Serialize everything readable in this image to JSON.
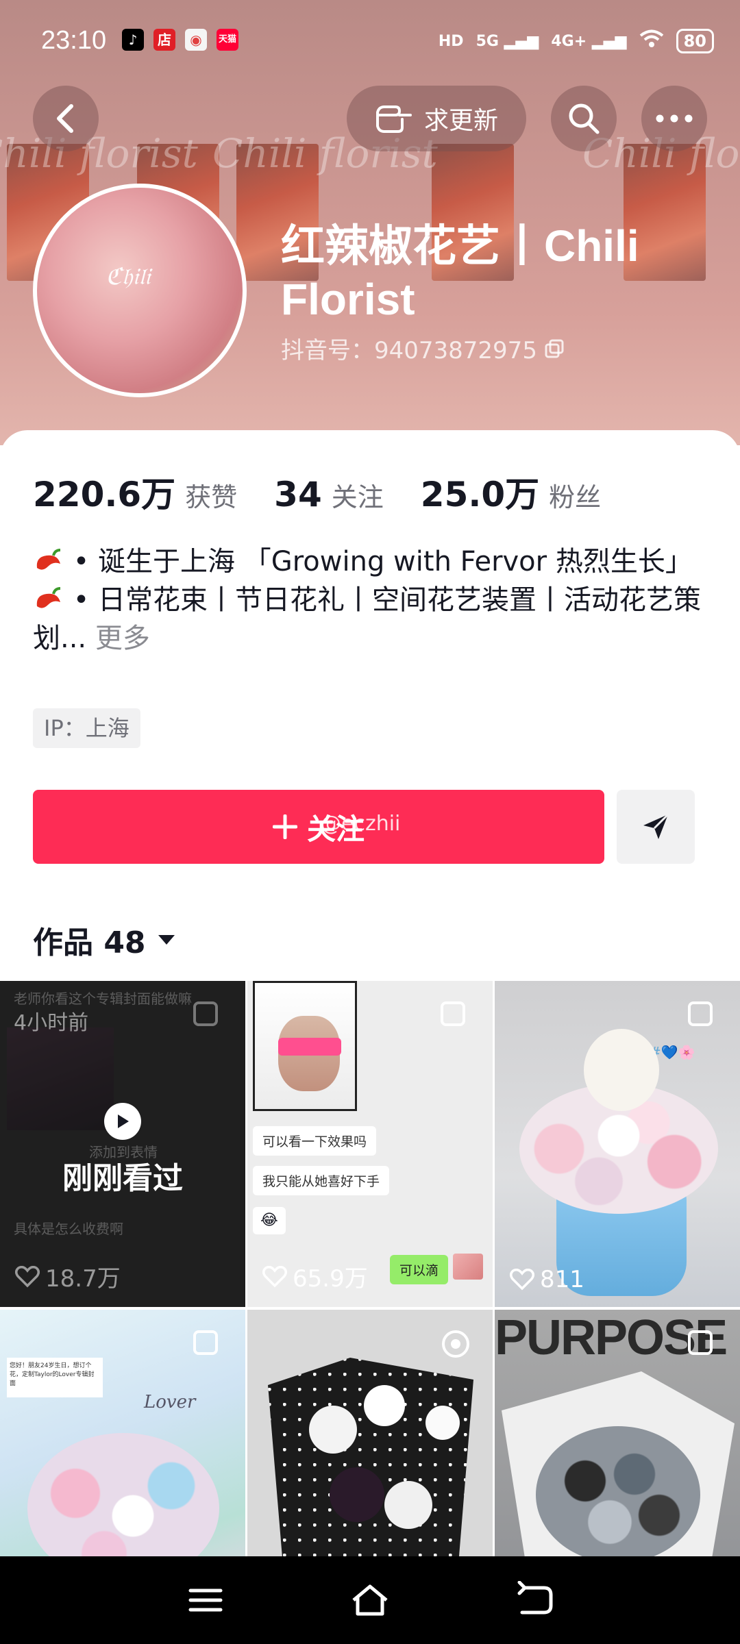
{
  "status_bar": {
    "time": "23:10",
    "hd": "HD",
    "signal_5g": "5G",
    "signal_4g": "4G+",
    "battery": "80",
    "apps": [
      {
        "icon": "tiktok-icon",
        "glyph": "♪",
        "color": "#000000"
      },
      {
        "icon": "store-icon",
        "glyph": "店",
        "color": "#e01f26"
      },
      {
        "icon": "photos-icon",
        "glyph": "◉",
        "color": "#f5f5f5"
      },
      {
        "icon": "tmall-icon",
        "glyph": "天猫",
        "color": "#ff0036"
      }
    ]
  },
  "header": {
    "request_update_label": "求更新"
  },
  "profile": {
    "name": "红辣椒花艺丨Chili Florist",
    "douyin_id": "抖音号：94073872975"
  },
  "stats": {
    "likes_value": "220.6万",
    "likes_label": "获赞",
    "following_value": "34",
    "following_label": "关注",
    "followers_value": "25.0万",
    "followers_label": "粉丝"
  },
  "bio": {
    "line1": "• 诞生于上海 「Growing with Fervor 热烈生长」",
    "line2": "• 日常花束丨节日花礼丨空间花艺装置丨活动花艺策划...",
    "more": "更多",
    "ip_tag": "IP：上海"
  },
  "actions": {
    "follow_label": "关注",
    "watermark": "@eczhii"
  },
  "works": {
    "label": "作品 48"
  },
  "grid": {
    "items": [
      {
        "likes": "18.7万",
        "time_badge": "4小时前",
        "watched_label": "刚刚看过",
        "chat_top": "老师你看这个专辑封面能做嘛",
        "chat_mid": "添加到表情",
        "chat_bottom": "具体是怎么收费啊"
      },
      {
        "likes": "65.9万",
        "bubble1": "可以看一下效果吗",
        "bubble2": "我只能从她喜好下手",
        "green_bubble": "可以滴"
      },
      {
        "likes": "811",
        "tag": "#💙🌸"
      },
      {
        "note": "您好！朋友24岁生日，想订个花，定制Taylor的Lover专辑封面",
        "sticker": "Lover"
      },
      {},
      {
        "brand": "PURPOSE"
      }
    ]
  },
  "colors": {
    "accent": "#fe2c55",
    "banner": "#c99590",
    "text_primary": "#161823",
    "text_secondary": "#6f7078"
  }
}
